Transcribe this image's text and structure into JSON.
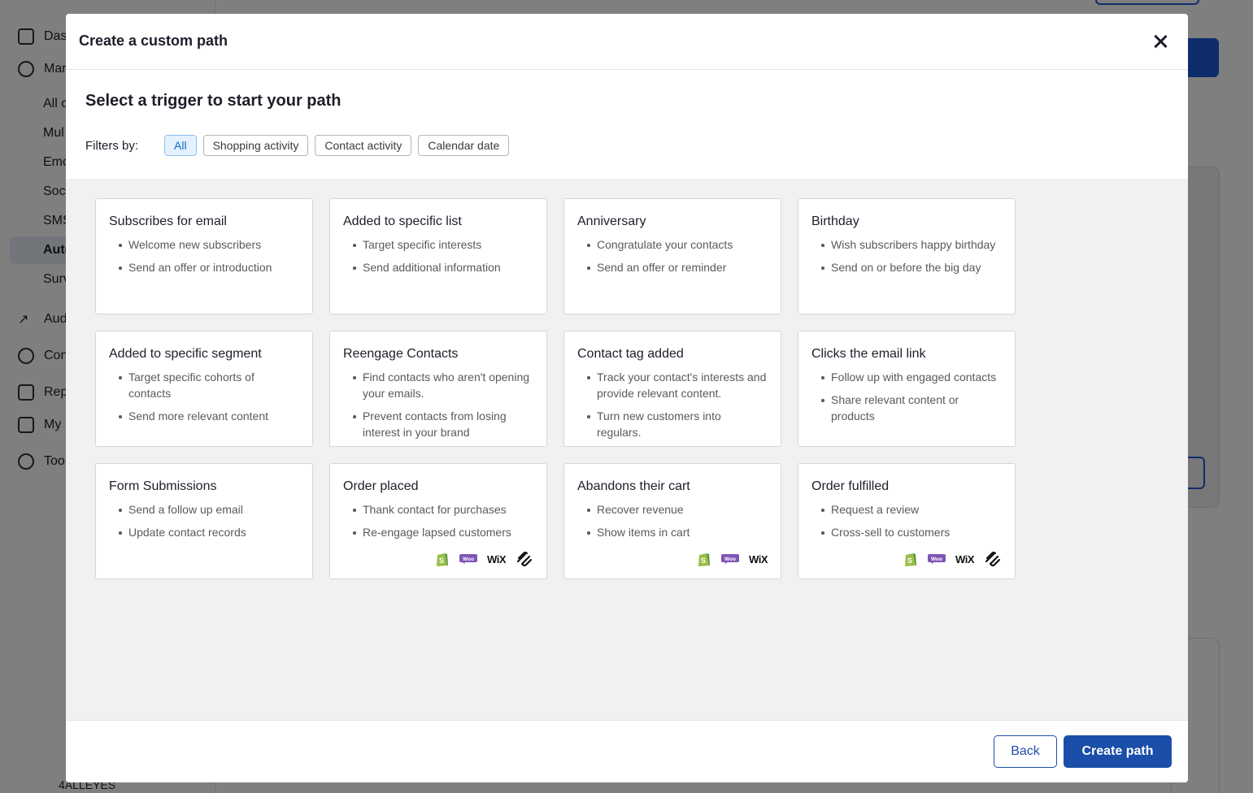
{
  "background": {
    "nav": [
      "Das",
      "Mar",
      "Aud",
      "Con",
      "Rep",
      "My",
      "Too"
    ],
    "subnav": [
      "All c",
      "Mul",
      "Emc",
      "Soc",
      "SMS",
      "Auto",
      "Surv"
    ],
    "footer_account": "4ALLEYES"
  },
  "modal": {
    "title": "Create a custom path",
    "subheading": "Select a trigger to start your path",
    "filters_label": "Filters by:",
    "filters": [
      {
        "label": "All",
        "active": true
      },
      {
        "label": "Shopping activity",
        "active": false
      },
      {
        "label": "Contact activity",
        "active": false
      },
      {
        "label": "Calendar date",
        "active": false
      }
    ],
    "cards": [
      {
        "title": "Subscribes for email",
        "bullets": [
          "Welcome new subscribers",
          "Send an offer or introduction"
        ],
        "integrations": []
      },
      {
        "title": "Added to specific list",
        "bullets": [
          "Target specific interests",
          "Send additional information"
        ],
        "integrations": []
      },
      {
        "title": "Anniversary",
        "bullets": [
          "Congratulate your contacts",
          "Send an offer or reminder"
        ],
        "integrations": []
      },
      {
        "title": "Birthday",
        "bullets": [
          "Wish subscribers happy birthday",
          "Send on or before the big day"
        ],
        "integrations": []
      },
      {
        "title": "Added to specific segment",
        "bullets": [
          "Target specific cohorts of contacts",
          "Send more relevant content"
        ],
        "integrations": []
      },
      {
        "title": "Reengage Contacts",
        "bullets": [
          "Find contacts who aren't opening your emails.",
          "Prevent contacts from losing interest in your brand"
        ],
        "integrations": []
      },
      {
        "title": "Contact tag added",
        "bullets": [
          "Track your contact's interests and provide relevant content.",
          "Turn new customers into regulars."
        ],
        "integrations": []
      },
      {
        "title": "Clicks the email link",
        "bullets": [
          "Follow up with engaged contacts",
          "Share relevant content or products"
        ],
        "integrations": []
      },
      {
        "title": "Form Submissions",
        "bullets": [
          "Send a follow up email",
          "Update contact records"
        ],
        "integrations": []
      },
      {
        "title": "Order placed",
        "bullets": [
          "Thank contact for purchases",
          "Re-engage lapsed customers"
        ],
        "integrations": [
          "shopify-icon",
          "woo-icon",
          "wix-icon",
          "squarespace-icon"
        ]
      },
      {
        "title": "Abandons their cart",
        "bullets": [
          "Recover revenue",
          "Show items in cart"
        ],
        "integrations": [
          "shopify-icon",
          "woo-icon",
          "wix-icon"
        ]
      },
      {
        "title": "Order fulfilled",
        "bullets": [
          "Request a review",
          "Cross-sell to customers"
        ],
        "integrations": [
          "shopify-icon",
          "woo-icon",
          "wix-icon",
          "squarespace-icon"
        ]
      }
    ],
    "back_label": "Back",
    "create_label": "Create path",
    "wix_text": "WiX",
    "woo_text": "Woo"
  },
  "colors": {
    "primary": "#1a4ea9",
    "chip_active_bg": "#e4f1fd",
    "shopify": "#95bf47",
    "woo": "#7f54b3"
  }
}
